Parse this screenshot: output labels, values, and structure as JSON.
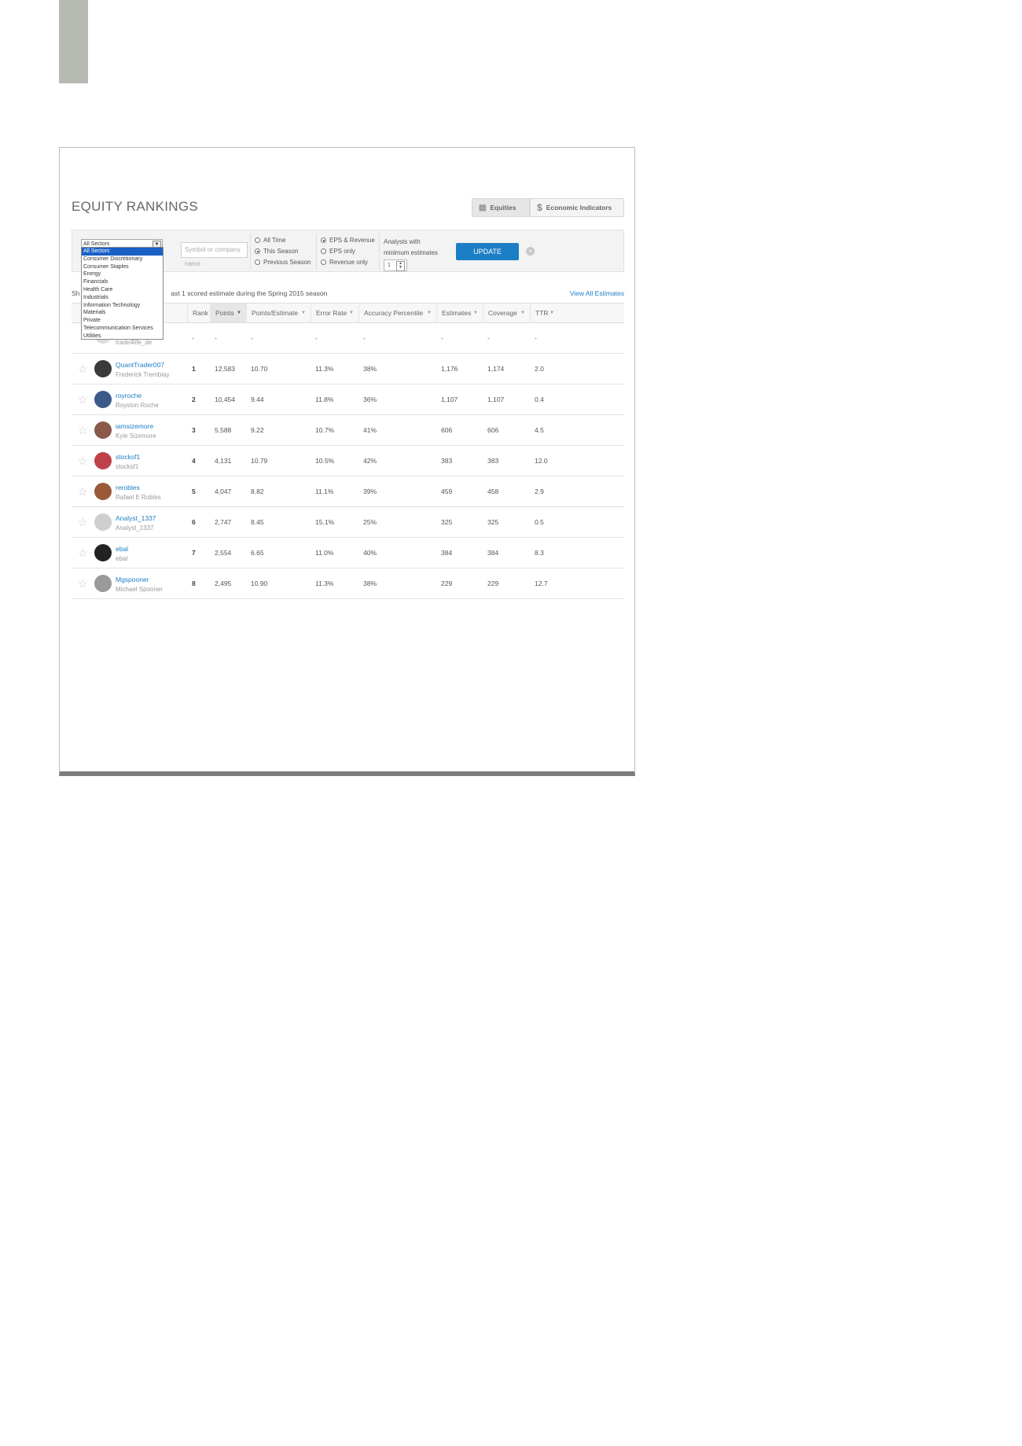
{
  "title": "EQUITY RANKINGS",
  "segments": {
    "equities": "Equities",
    "equities_icon": "chart-icon",
    "economic": "Economic Indicators",
    "economic_icon": "dollar-icon"
  },
  "filters": {
    "sector_selected": "All Sectors",
    "search_placeholder": "Symbol or company name",
    "time_options": [
      {
        "label": "All Time",
        "checked": false
      },
      {
        "label": "This Season",
        "checked": true
      },
      {
        "label": "Previous Season",
        "checked": false
      }
    ],
    "type_options": [
      {
        "label": "EPS & Revenue",
        "checked": true
      },
      {
        "label": "EPS only",
        "checked": false
      },
      {
        "label": "Revenue only",
        "checked": false
      }
    ],
    "min_label_1": "Analysts with",
    "min_label_2": "minimum estimates",
    "min_value": "1",
    "update_label": "UPDATE"
  },
  "sector_options": [
    "All Sectors",
    "Consumer Discretionary",
    "Consumer Staples",
    "Energy",
    "Financials",
    "Health Care",
    "Industrials",
    "Information Technology",
    "Materials",
    "Private",
    "Telecommunication Services",
    "Utilities"
  ],
  "showing_prefix": "Sh",
  "showing_text": "ast 1 scored estimate during the Spring 2015 season",
  "view_all": "View All Estimates",
  "columns": {
    "rank": "Rank",
    "points": "Points",
    "points_estimate": "Points/Estimate",
    "error_rate": "Error Rate",
    "accuracy": "Accuracy Percentile",
    "estimates": "Estimates",
    "coverage": "Coverage",
    "ttr": "TTR"
  },
  "first_row": {
    "real": "trade4life_de",
    "dash": "-"
  },
  "rows": [
    {
      "user": "QuantTrader007",
      "name": "Frederick Tremblay",
      "rank": "1",
      "points": "12,583",
      "pe": "10.70",
      "err": "11.3%",
      "acc": "38%",
      "est": "1,176",
      "cov": "1,174",
      "ttr": "2.0",
      "avatar": "#3a3a3a"
    },
    {
      "user": "royroche",
      "name": "Royston Roche",
      "rank": "2",
      "points": "10,454",
      "pe": "9.44",
      "err": "11.8%",
      "acc": "36%",
      "est": "1,107",
      "cov": "1,107",
      "ttr": "0.4",
      "avatar": "#3b5a8a"
    },
    {
      "user": "iamsizemore",
      "name": "Kyle Sizemore",
      "rank": "3",
      "points": "5,588",
      "pe": "9.22",
      "err": "10.7%",
      "acc": "41%",
      "est": "606",
      "cov": "606",
      "ttr": "4.5",
      "avatar": "#8a5a4a"
    },
    {
      "user": "stocksf1",
      "name": "stocksf1",
      "rank": "4",
      "points": "4,131",
      "pe": "10.79",
      "err": "10.5%",
      "acc": "42%",
      "est": "383",
      "cov": "383",
      "ttr": "12.0",
      "avatar": "#c0404a"
    },
    {
      "user": "rerobles",
      "name": "Rafael E Robles",
      "rank": "5",
      "points": "4,047",
      "pe": "8.82",
      "err": "11.1%",
      "acc": "39%",
      "est": "459",
      "cov": "458",
      "ttr": "2.9",
      "avatar": "#9a5a3a"
    },
    {
      "user": "Analyst_1337",
      "name": "Analyst_1337",
      "rank": "6",
      "points": "2,747",
      "pe": "8.45",
      "err": "15.1%",
      "acc": "25%",
      "est": "325",
      "cov": "325",
      "ttr": "0.5",
      "avatar": "#cfcfcf"
    },
    {
      "user": "ebal",
      "name": "ebal",
      "rank": "7",
      "points": "2,554",
      "pe": "6.65",
      "err": "11.0%",
      "acc": "40%",
      "est": "384",
      "cov": "384",
      "ttr": "8.3",
      "avatar": "#222222"
    },
    {
      "user": "Mgspooner",
      "name": "Michael Spooner",
      "rank": "8",
      "points": "2,495",
      "pe": "10.90",
      "err": "11.3%",
      "acc": "38%",
      "est": "229",
      "cov": "229",
      "ttr": "12.7",
      "avatar": "#9a9a9a"
    }
  ],
  "colors": {
    "accent": "#1c7ec4",
    "sidebar_block": "#b6bab3"
  }
}
